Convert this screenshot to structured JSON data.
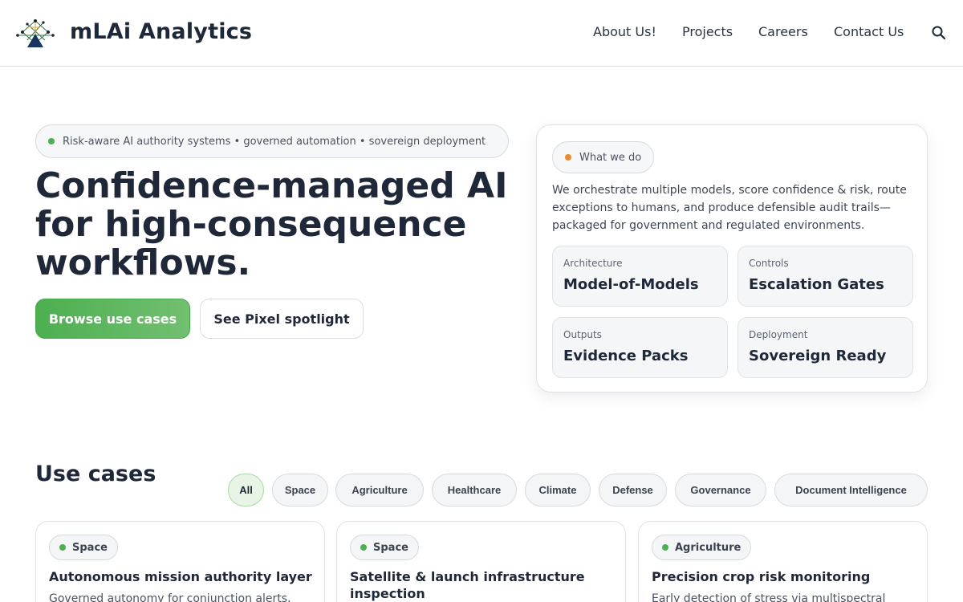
{
  "brand": {
    "name": "mLAi Analytics"
  },
  "nav": {
    "items": [
      "About Us!",
      "Projects",
      "Careers",
      "Contact Us"
    ],
    "search_icon": "search-icon"
  },
  "hero": {
    "banner": "Risk-aware AI authority systems • governed automation • sovereign deployment",
    "title_lines": [
      "Confidence-managed AI",
      "for high-consequence",
      "workflows."
    ],
    "primary_cta": "Browse use cases",
    "secondary_cta": "See Pixel spotlight"
  },
  "what_we_do": {
    "label": "What we do",
    "text_lines": [
      "We orchestrate multiple models, score confidence & risk, route",
      "exceptions to humans, and produce defensible audit trails—",
      "packaged for government and regulated environments."
    ],
    "cards": [
      {
        "kicker": "Architecture",
        "value": "Model-of-Models"
      },
      {
        "kicker": "Controls",
        "value": "Escalation Gates"
      },
      {
        "kicker": "Outputs",
        "value": "Evidence Packs"
      },
      {
        "kicker": "Deployment",
        "value": "Sovereign Ready"
      }
    ]
  },
  "use_cases": {
    "heading": "Use cases",
    "filters": [
      "All",
      "Space",
      "Agriculture",
      "Healthcare",
      "Climate",
      "Defense",
      "Governance",
      "Document Intelligence"
    ],
    "active_filter": "All",
    "cards": [
      {
        "tag": "Space",
        "title": "Autonomous mission authority layer",
        "desc": "Governed autonomy for conjunction alerts,"
      },
      {
        "tag": "Space",
        "title": "Satellite & launch infrastructure inspection",
        "desc": ""
      },
      {
        "tag": "Agriculture",
        "title": "Precision crop risk monitoring",
        "desc": "Early detection of stress via multispectral"
      }
    ]
  },
  "colors": {
    "accent_green": "#4caf50",
    "accent_orange": "#ef8a2b",
    "text_dark": "#1e2838"
  }
}
